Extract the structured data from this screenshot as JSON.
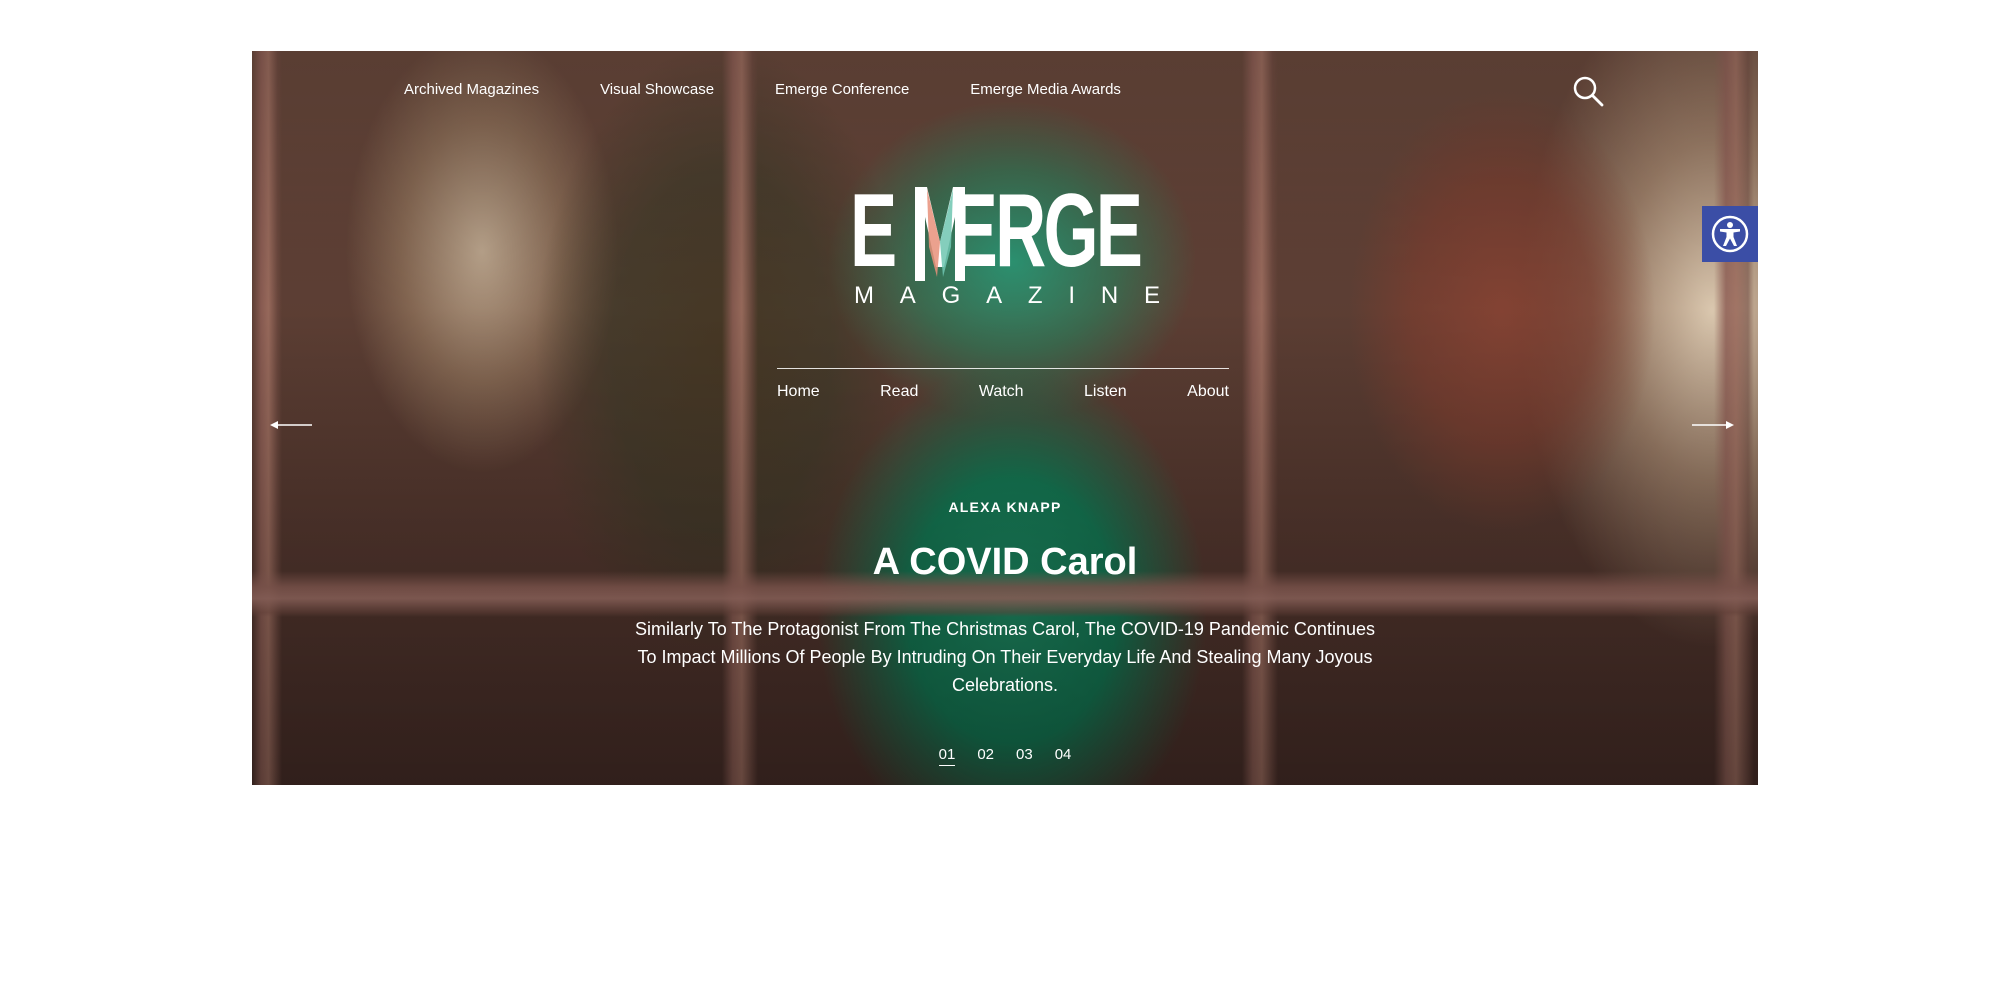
{
  "top_nav": {
    "items": [
      {
        "label": "Archived Magazines"
      },
      {
        "label": "Visual Showcase"
      },
      {
        "label": "Emerge Conference"
      },
      {
        "label": "Emerge Media Awards"
      }
    ]
  },
  "search": {
    "icon": "search-icon"
  },
  "accessibility": {
    "icon": "accessibility-icon",
    "color": "#3b4ea6"
  },
  "logo": {
    "word_before": "E",
    "word_m": "M",
    "word_after": "ERGE",
    "sub_letters": [
      "M",
      "A",
      "G",
      "A",
      "Z",
      "I",
      "N",
      "E"
    ]
  },
  "main_nav": {
    "items": [
      {
        "label": "Home"
      },
      {
        "label": "Read"
      },
      {
        "label": "Watch"
      },
      {
        "label": "Listen"
      },
      {
        "label": "About"
      }
    ]
  },
  "slider": {
    "prev_icon": "arrow-left-icon",
    "next_icon": "arrow-right-icon",
    "author": "ALEXA KNAPP",
    "title": "A COVID Carol",
    "excerpt": "Similarly To The Protagonist From The Christmas Carol, The COVID-19 Pandemic Continues To Impact Millions Of People By Intruding On Their Everyday Life And Stealing Many Joyous Celebrations.",
    "pages": [
      "01",
      "02",
      "03",
      "04"
    ],
    "active_page": "01"
  }
}
